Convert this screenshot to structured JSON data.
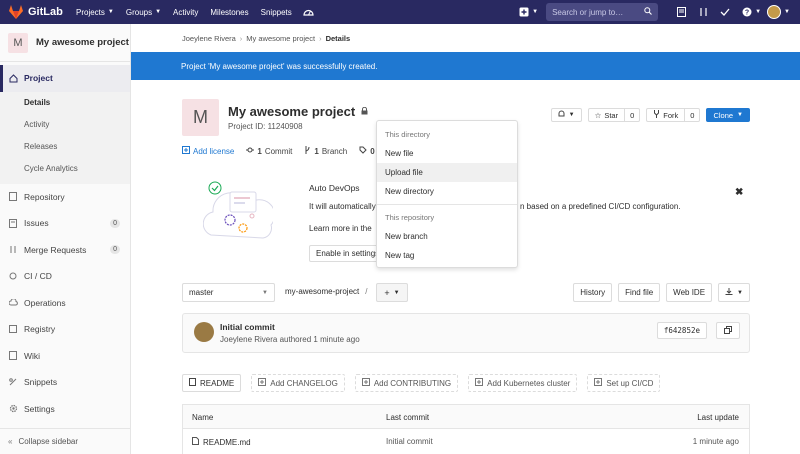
{
  "navbar": {
    "brand": "GitLab",
    "links": [
      {
        "label": "Projects",
        "dropdown": true
      },
      {
        "label": "Groups",
        "dropdown": true
      },
      {
        "label": "Activity",
        "dropdown": false
      },
      {
        "label": "Milestones",
        "dropdown": false
      },
      {
        "label": "Snippets",
        "dropdown": false
      }
    ],
    "search_placeholder": "Search or jump to…",
    "colors": {
      "navbar": "#292961",
      "accent": "#1f78d1"
    }
  },
  "sidebar": {
    "project_initial": "M",
    "project_name": "My awesome project",
    "items": [
      {
        "label": "Project",
        "icon": "home-icon",
        "active": true
      },
      {
        "label": "Repository",
        "icon": "book-icon"
      },
      {
        "label": "Issues",
        "icon": "issues-icon",
        "count": "0"
      },
      {
        "label": "Merge Requests",
        "icon": "merge-request-icon",
        "count": "0"
      },
      {
        "label": "CI / CD",
        "icon": "rocket-icon"
      },
      {
        "label": "Operations",
        "icon": "cloud-icon"
      },
      {
        "label": "Registry",
        "icon": "registry-icon"
      },
      {
        "label": "Wiki",
        "icon": "wiki-icon"
      },
      {
        "label": "Snippets",
        "icon": "snippet-icon"
      },
      {
        "label": "Settings",
        "icon": "gear-icon"
      }
    ],
    "subitems": [
      "Details",
      "Activity",
      "Releases",
      "Cycle Analytics"
    ],
    "collapse_label": "Collapse sidebar"
  },
  "breadcrumb": [
    "Joeylene Rivera",
    "My awesome project",
    "Details"
  ],
  "flash": "Project 'My awesome project' was successfully created.",
  "project": {
    "initial": "M",
    "title": "My awesome project",
    "id_text": "Project ID: 11240908",
    "stats": {
      "add_license": "Add license",
      "commits_count": "1",
      "commits_label": "Commit",
      "branches_count": "1",
      "branches_label": "Branch",
      "tags_count": "0"
    },
    "actions": {
      "star_label": "Star",
      "star_count": "0",
      "fork_label": "Fork",
      "fork_count": "0",
      "clone_label": "Clone"
    }
  },
  "autodevops": {
    "title": "Auto DevOps",
    "text_left": "It will automatically",
    "text_right": "n based on a predefined CI/CD configuration.",
    "learn_more": "Learn more in the",
    "enable_button": "Enable in settings"
  },
  "dropdown": {
    "section1": "This directory",
    "items1": [
      "New file",
      "Upload file",
      "New directory"
    ],
    "section2": "This repository",
    "items2": [
      "New branch",
      "New tag"
    ]
  },
  "repo": {
    "branch": "master",
    "path": "my-awesome-project",
    "path_sep": "/",
    "buttons": [
      "History",
      "Find file",
      "Web IDE"
    ]
  },
  "commit": {
    "title": "Initial commit",
    "meta": "Joeylene Rivera authored 1 minute ago",
    "sha": "f642852e"
  },
  "file_buttons": [
    "README",
    "Add CHANGELOG",
    "Add CONTRIBUTING",
    "Add Kubernetes cluster",
    "Set up CI/CD"
  ],
  "table": {
    "headers": [
      "Name",
      "Last commit",
      "Last update"
    ],
    "rows": [
      {
        "name": "README.md",
        "last_commit": "Initial commit",
        "last_update": "1 minute ago"
      }
    ]
  }
}
